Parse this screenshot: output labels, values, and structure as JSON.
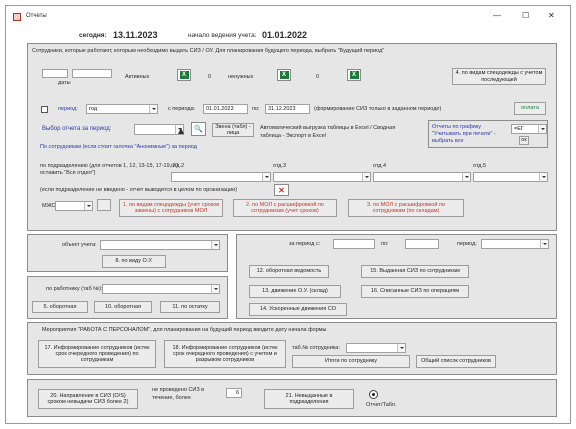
{
  "window": {
    "title": "Отчеты",
    "minimize_glyph": "—",
    "maximize_glyph": "☐",
    "close_glyph": "✕",
    "today_label": "сегодня:",
    "today_value": "13.11.2023",
    "start_label": "начало ведения учета:",
    "start_value": "01.01.2022"
  },
  "top_panel": {
    "info_text": "Сотрудники, которые работают, которым необходимо выдать СИЗ / ОУ. Для планирования будущего периода, выбрать \"Будущий период\"",
    "dates_label": "даты",
    "work_label": "Активных",
    "zero_label": "0",
    "zero2_label": "0",
    "not_needed_label": "ненужных",
    "excel_glyph": "X",
    "no_spec_button": "4. по видам спецодежды с учетом последующей",
    "period_label": "период:",
    "period_value": "год",
    "from_label": "с периода:",
    "from_value": "01.01.2023",
    "to_label": "по:",
    "to_value": "31.12.2023",
    "period_note": "(формирование СИЗ только в заданном периоде)",
    "pay_button": "оплатa",
    "report_choice_label": "Выбор отчета за период:",
    "report_choice_value": "",
    "employee_note": "По сотрудникам (если стоит галочка \"Анонимные\") за период",
    "view_button": "Звена (табл) - лица",
    "export_note": "Автоматический выгрузка таблицы в Excel / Сводная таблица - Экспорт в Excel",
    "print_header_label": "Отчеты по графику \"Учитывать при печати\" - выбрать все",
    "print_header_value": "=ЕГ",
    "print_header_btn": "ок",
    "dept_label": "по подразделению (для отчетов 1, 12, 13-15, 17-19, 21 оставить \"Вся отдел\")",
    "col2_label": "отд.2",
    "col3_label": "отд.3",
    "col4_label": "отд.4",
    "col5_label": "отд.5",
    "no_dept_note": "(если подразделение не введено - отчет выводится в целом по организации)",
    "filter_label": "МЖО",
    "btn_1": "1. по видам спецодежды (учет сроков замены) с сотрудников МОЛ",
    "btn_2": "2. по МОЛ с расшифровкой по сотрудникам (учет сроков)",
    "btn_3": "3. по МОЛ с расшифровкой по сотрудникам (по складам)"
  },
  "middle_left": {
    "object_label": "объект учета:",
    "object_value": "",
    "btn_8": "8. по виду О.У.",
    "worker_label": "по работнику (таб №):",
    "worker_value": "",
    "btn_5": "5. оборотная",
    "btn_10": "10. оборотная",
    "btn_11": "11. по остатку"
  },
  "middle_right": {
    "period_label": "за период с:",
    "from_value": "",
    "to_label": "по:",
    "to_value": "",
    "period_type_label": "период:",
    "period_type_value": "",
    "btn_12": "12. оборотная ведомость",
    "btn_15": "15. Выданная СИЗ по сотрудникам",
    "btn_13": "13. движение О.У. (склад)",
    "btn_16": "16. Списанные СИЗ по операциям",
    "btn_14": "14. Ускоренные движения СО"
  },
  "forecast": {
    "title_text": "Мероприятия \"РАБОТА С ПЕРСОНАЛОМ\", для планирования на будущий период вводите дату начала формы",
    "btn_17": "17. Информирование сотрудников (истек срок очередного проведения) по сотрудникам",
    "btn_18": "18. Информирование сотрудников (истек срок очередного проведения) с учетом и разрывом сотрудников",
    "tab_label": "таб.№ сотрудника:",
    "tab_value": "",
    "btn_employee": "Итоги по сотруднику",
    "btn_total": "Общий список сотрудников"
  },
  "bottom": {
    "btn_20": "20. Направление в СИЗ (O/S) сроком невыдачи СИЗ более 2)",
    "days_label": "не проведено СИЗ в течение, более",
    "days_value": "6",
    "btn_21": "21. Невыданные в подразделения",
    "radio_label": "Отчет/Табл."
  }
}
